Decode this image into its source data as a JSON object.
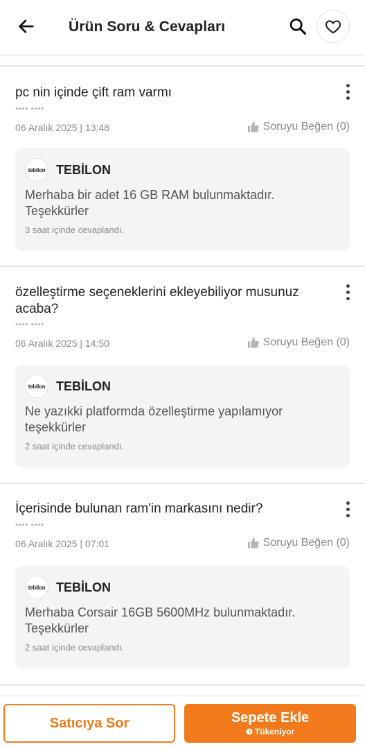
{
  "header": {
    "title": "Ürün Soru & Cevapları",
    "icons": {
      "back": "arrow-left-icon",
      "search": "search-icon",
      "favorite": "heart-icon"
    }
  },
  "questions": [
    {
      "text": "pc nin  içinde çift ram varmı",
      "author": "**** ****",
      "date": "06 Aralık 2025 | 13:48",
      "like_label": "Soruyu Beğen (0)",
      "answer": {
        "seller_logo_text": "tebilon",
        "seller_name": "TEBİLON",
        "text": "Merhaba bir adet 16 GB RAM bulunmaktadır. Teşekkürler",
        "time": "3 saat içinde cevaplandı."
      }
    },
    {
      "text": "özelleştirme seçeneklerini ekleyebiliyor musunuz acaba?",
      "author": "**** ****",
      "date": "06 Aralık 2025 | 14:50",
      "like_label": "Soruyu Beğen (0)",
      "answer": {
        "seller_logo_text": "tebilon",
        "seller_name": "TEBİLON",
        "text": "Ne yazıkki platformda özelleştirme yapılamıyor teşekkürler",
        "time": "2 saat içinde cevaplandı."
      }
    },
    {
      "text": "İçerisinde bulunan ram'in markasını nedir?",
      "author": "**** ****",
      "date": "06 Aralık 2025 | 07:01",
      "like_label": "Soruyu Beğen (0)",
      "answer": {
        "seller_logo_text": "tebilon",
        "seller_name": "TEBİLON",
        "text": "Merhaba Corsair 16GB 5600MHz bulunmaktadır. Teşekkürler",
        "time": "2 saat içinde cevaplandı."
      }
    }
  ],
  "bottom_bar": {
    "ask_seller_label": "Satıcıya Sor",
    "add_to_cart_label": "Sepete Ekle",
    "stock_status": "Tükeniyor"
  },
  "colors": {
    "accent": "#f27a1a",
    "answer_bg": "#f4f4f4"
  }
}
